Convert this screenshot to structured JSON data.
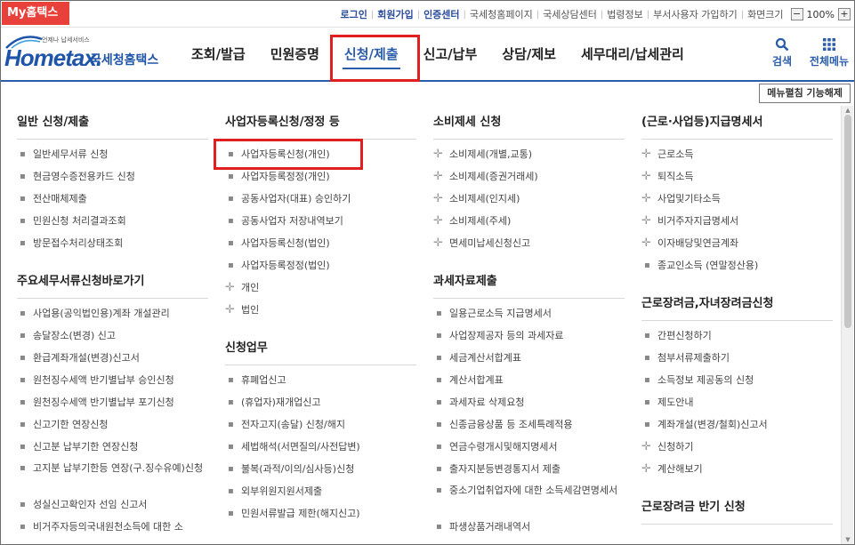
{
  "topbar": {
    "my_hometax": "My홈택스",
    "links": [
      {
        "label": "로그인",
        "bold": true
      },
      {
        "label": "회원가입",
        "bold": true
      },
      {
        "label": "인증센터",
        "bold": true
      },
      {
        "label": "국세청홈페이지",
        "bold": false
      },
      {
        "label": "국세상담센터",
        "bold": false
      },
      {
        "label": "법령정보",
        "bold": false
      },
      {
        "label": "부서사용자 가입하기",
        "bold": false
      },
      {
        "label": "화면크기",
        "bold": false
      }
    ],
    "zoom": "100%",
    "zoom_minus": "−",
    "zoom_plus": "+"
  },
  "header": {
    "logo_small": "언제나 납세서비스",
    "logo_mark": "Hometax.",
    "logo_name": "국세청홈택스",
    "gnb": [
      "조회/발급",
      "민원증명",
      "신청/제출",
      "신고/납부",
      "상담/제보",
      "세무대리/납세관리"
    ],
    "active_gnb": "신청/제출",
    "search_label": "검색",
    "allmenu_label": "전체메뉴"
  },
  "menu_toggle": "메뉴펼침 기능해제",
  "columns": [
    {
      "sections": [
        {
          "title": "일반 신청/제출",
          "items": [
            {
              "t": "일반세무서류 신청"
            },
            {
              "t": "현금영수증전용카드 신청"
            },
            {
              "t": "전산매체제출"
            },
            {
              "t": "민원신청 처리결과조회"
            },
            {
              "t": "방문접수처리상태조회"
            }
          ]
        },
        {
          "title": "주요세무서류신청바로가기",
          "items": [
            {
              "t": "사업용(공익법인용)계좌 개설관리"
            },
            {
              "t": "송달장소(변경) 신고"
            },
            {
              "t": "환급계좌개설(변경)신고서"
            },
            {
              "t": "원천징수세액 반기별납부 승인신청"
            },
            {
              "t": "원천징수세액 반기별납부 포기신청"
            },
            {
              "t": "신고기한 연장신청"
            },
            {
              "t": "신고분 납부기한 연장신청"
            },
            {
              "t": "고지분 납부기한등 연장(구.징수유예)신청",
              "tall": true
            },
            {
              "t": "성실신고확인자 선임 신고서"
            },
            {
              "t": "비거주자등의국내원천소득에 대한 소"
            }
          ]
        }
      ]
    },
    {
      "sections": [
        {
          "title": "사업자등록신청/정정 등",
          "items": [
            {
              "t": "사업자등록신청(개인)"
            },
            {
              "t": "사업자등록정정(개인)"
            },
            {
              "t": "공동사업자(대표) 승인하기"
            },
            {
              "t": "공동사업자 저장내역보기"
            },
            {
              "t": "사업자등록신청(법인)"
            },
            {
              "t": "사업자등록정정(법인)"
            },
            {
              "t": "개인",
              "plus": true
            },
            {
              "t": "법인",
              "plus": true
            }
          ]
        },
        {
          "title": "신청업무",
          "items": [
            {
              "t": "휴폐업신고"
            },
            {
              "t": "(휴업자)재개업신고"
            },
            {
              "t": "전자고지(송달) 신청/해지"
            },
            {
              "t": "세법해석(서면질의/사전답변)"
            },
            {
              "t": "불복(과적/이의/심사등)신청"
            },
            {
              "t": "외부위원지원서제출"
            },
            {
              "t": "민원서류발급 제한(해지신고)"
            }
          ]
        }
      ]
    },
    {
      "sections": [
        {
          "title": "소비제세 신청",
          "items": [
            {
              "t": "소비제세(개별,교통)",
              "plus": true
            },
            {
              "t": "소비제세(증권거래세)",
              "plus": true
            },
            {
              "t": "소비제세(인지세)",
              "plus": true
            },
            {
              "t": "소비제세(주세)",
              "plus": true
            },
            {
              "t": "면세미납세신청신고",
              "plus": true
            }
          ]
        },
        {
          "title": "과세자료제출",
          "items": [
            {
              "t": "일용근로소득 지급명세서"
            },
            {
              "t": "사업장제공자 등의 과세자료"
            },
            {
              "t": "세금계산서합계표"
            },
            {
              "t": "계산서합계표"
            },
            {
              "t": "과세자료 삭제요청"
            },
            {
              "t": "신종금융상품 등 조세특례적용"
            },
            {
              "t": "연금수령개시및해지명세서"
            },
            {
              "t": "출자지분등변경통지서 제출"
            },
            {
              "t": "중소기업취업자에 대한 소득세감면명세서",
              "tall": true
            },
            {
              "t": "파생상품거래내역서"
            }
          ]
        }
      ]
    },
    {
      "sections": [
        {
          "title": "(근로·사업등)지급명세서",
          "items": [
            {
              "t": "근로소득",
              "plus": true
            },
            {
              "t": "퇴직소득",
              "plus": true
            },
            {
              "t": "사업및기타소득",
              "plus": true
            },
            {
              "t": "비거주자지급명세서",
              "plus": true
            },
            {
              "t": "이자배당및연금계좌",
              "plus": true
            },
            {
              "t": "종교인소득 (연말정산용)"
            }
          ]
        },
        {
          "title": "근로장려금,자녀장려금신청",
          "items": [
            {
              "t": "간편신청하기"
            },
            {
              "t": "첨부서류제출하기"
            },
            {
              "t": "소득정보 제공동의 신청"
            },
            {
              "t": "제도안내"
            },
            {
              "t": "계좌개설(변경/철회)신고서"
            },
            {
              "t": "신청하기",
              "plus": true
            },
            {
              "t": "계산해보기",
              "plus": true
            }
          ]
        },
        {
          "title": "근로장려금 반기 신청",
          "items": []
        }
      ]
    }
  ]
}
